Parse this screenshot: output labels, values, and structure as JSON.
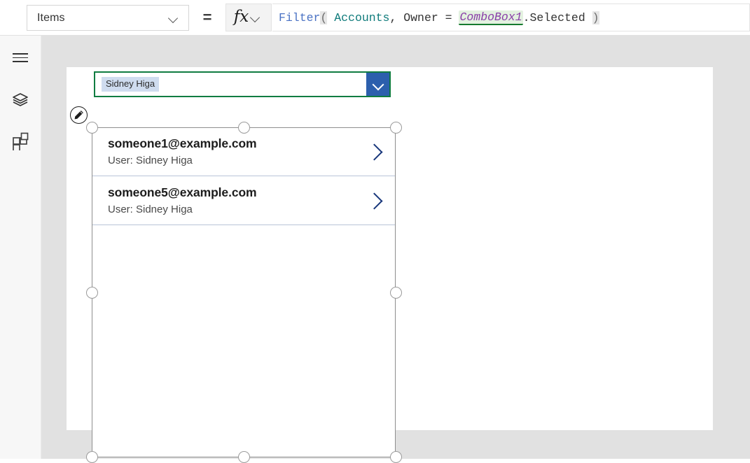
{
  "formula_bar": {
    "property_selected": "Items",
    "equals": "=",
    "fx_label": "fx",
    "formula_tokens": [
      {
        "text": "Filter",
        "type": "fn"
      },
      {
        "text": "(",
        "type": "paren"
      },
      {
        "text": " ",
        "type": "plain"
      },
      {
        "text": "Accounts",
        "type": "table"
      },
      {
        "text": ", Owner = ",
        "type": "plain"
      },
      {
        "text": "ComboBox1",
        "type": "ctrl"
      },
      {
        "text": ".Selected ",
        "type": "plain"
      },
      {
        "text": ")",
        "type": "paren"
      }
    ],
    "formula_text": "Filter( Accounts, Owner = ComboBox1.Selected )"
  },
  "left_rail": {
    "items": [
      {
        "name": "menu-icon",
        "label": "Menu"
      },
      {
        "name": "tree-view-icon",
        "label": "Tree view"
      },
      {
        "name": "insert-icon",
        "label": "Insert"
      }
    ]
  },
  "canvas": {
    "combobox": {
      "selected_chip": "Sidney Higa",
      "dropdown_icon": "chevron-down-icon",
      "border_color": "#107c41",
      "chip_background": "#cfdcef",
      "button_color": "#2c5fad"
    },
    "gallery": {
      "edit_badge_icon": "pencil-edit-icon",
      "chevron_icon": "chevron-right-icon",
      "separator_color": "#b9c4d8",
      "rows": [
        {
          "title": "someone1@example.com",
          "subtitle": "User: Sidney Higa"
        },
        {
          "title": "someone5@example.com",
          "subtitle": "User: Sidney Higa"
        }
      ]
    }
  }
}
